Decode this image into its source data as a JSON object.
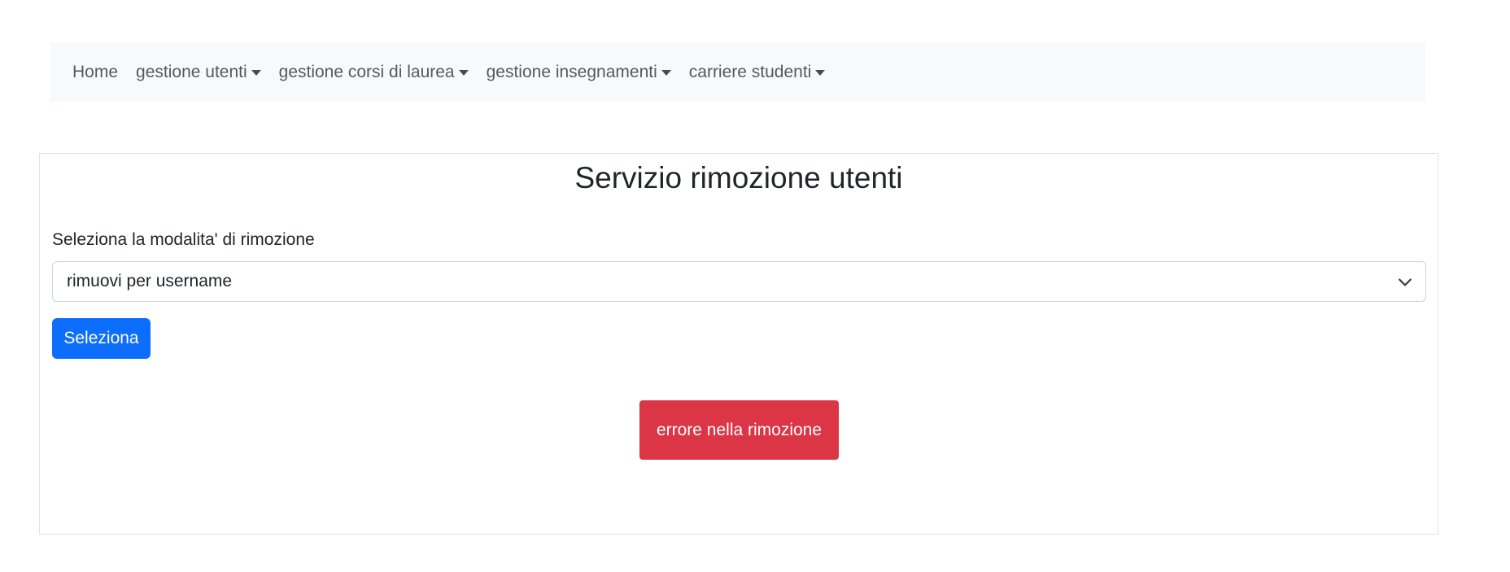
{
  "navbar": {
    "items": [
      {
        "label": "Home",
        "dropdown": false
      },
      {
        "label": "gestione utenti",
        "dropdown": true
      },
      {
        "label": "gestione corsi di laurea",
        "dropdown": true
      },
      {
        "label": "gestione insegnamenti",
        "dropdown": true
      },
      {
        "label": "carriere studenti",
        "dropdown": true
      }
    ]
  },
  "main": {
    "title": "Servizio rimozione utenti",
    "select_label": "Seleziona la modalita' di rimozione",
    "select_value": "rimuovi per username",
    "submit_label": "Seleziona",
    "error_message": "errore nella rimozione"
  },
  "colors": {
    "primary": "#0d6efd",
    "danger": "#dc3545",
    "navbar_bg": "#f8f9fa"
  }
}
